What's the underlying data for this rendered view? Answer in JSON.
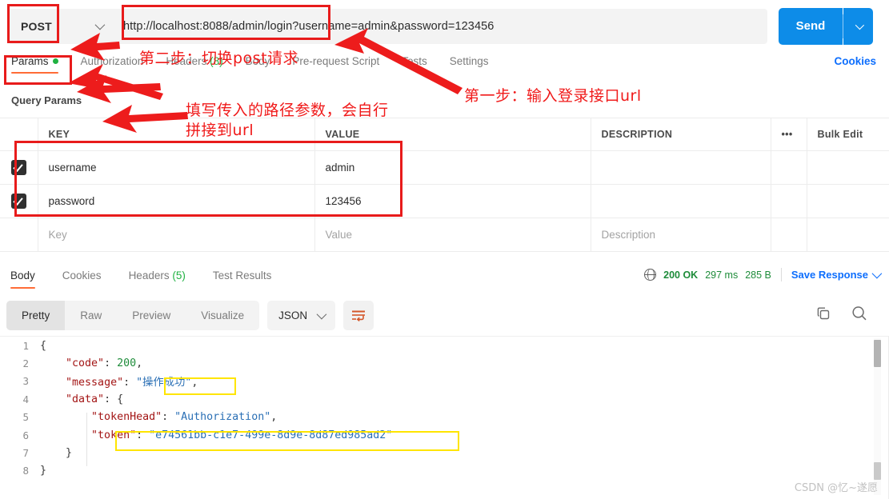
{
  "request": {
    "method": "POST",
    "url": "http://localhost:8088/admin/login?username=admin&password=123456",
    "send_label": "Send",
    "tabs": [
      {
        "label": "Params",
        "active": true,
        "dot": true
      },
      {
        "label": "Authorization",
        "active": false
      },
      {
        "label": "Headers",
        "count": "(8)",
        "active": false
      },
      {
        "label": "Body",
        "active": false
      },
      {
        "label": "Pre-request Script",
        "active": false
      },
      {
        "label": "Tests",
        "active": false
      },
      {
        "label": "Settings",
        "active": false
      }
    ],
    "cookies_link": "Cookies"
  },
  "query_params": {
    "title": "Query Params",
    "columns": [
      "KEY",
      "VALUE",
      "DESCRIPTION"
    ],
    "dots_label": "•••",
    "bulk_edit_label": "Bulk Edit",
    "rows": [
      {
        "checked": true,
        "key": "username",
        "value": "admin",
        "description": ""
      },
      {
        "checked": true,
        "key": "password",
        "value": "123456",
        "description": ""
      }
    ],
    "placeholder_row": {
      "key": "Key",
      "value": "Value",
      "description": "Description"
    }
  },
  "response": {
    "tabs": [
      {
        "label": "Body",
        "active": true
      },
      {
        "label": "Cookies",
        "active": false
      },
      {
        "label": "Headers",
        "count": "(5)",
        "active": false
      },
      {
        "label": "Test Results",
        "active": false
      }
    ],
    "status": {
      "code": "200 OK",
      "time": "297 ms",
      "size": "285 B",
      "save_label": "Save Response"
    },
    "view_modes": [
      {
        "label": "Pretty",
        "active": true
      },
      {
        "label": "Raw",
        "active": false
      },
      {
        "label": "Preview",
        "active": false
      },
      {
        "label": "Visualize",
        "active": false
      }
    ],
    "format": "JSON",
    "body_lines": [
      {
        "num": "1",
        "indent": 0,
        "tokens": [
          {
            "t": "{",
            "c": "p"
          }
        ]
      },
      {
        "num": "2",
        "indent": 1,
        "tokens": [
          {
            "t": "\"code\"",
            "c": "k"
          },
          {
            "t": ": ",
            "c": "p"
          },
          {
            "t": "200",
            "c": "n"
          },
          {
            "t": ",",
            "c": "p"
          }
        ]
      },
      {
        "num": "3",
        "indent": 1,
        "tokens": [
          {
            "t": "\"message\"",
            "c": "k"
          },
          {
            "t": ": ",
            "c": "p"
          },
          {
            "t": "\"操作成功\"",
            "c": "s"
          },
          {
            "t": ",",
            "c": "p"
          }
        ]
      },
      {
        "num": "4",
        "indent": 1,
        "tokens": [
          {
            "t": "\"data\"",
            "c": "k"
          },
          {
            "t": ": ",
            "c": "p"
          },
          {
            "t": "{",
            "c": "p"
          }
        ]
      },
      {
        "num": "5",
        "indent": 2,
        "tokens": [
          {
            "t": "\"tokenHead\"",
            "c": "k"
          },
          {
            "t": ": ",
            "c": "p"
          },
          {
            "t": "\"Authorization\"",
            "c": "s"
          },
          {
            "t": ",",
            "c": "p"
          }
        ]
      },
      {
        "num": "6",
        "indent": 2,
        "tokens": [
          {
            "t": "\"token\"",
            "c": "k"
          },
          {
            "t": ": ",
            "c": "p"
          },
          {
            "t": "\"e74561bb-c1e7-499e-8d9e-8d87ed985ad2\"",
            "c": "s"
          }
        ]
      },
      {
        "num": "7",
        "indent": 1,
        "tokens": [
          {
            "t": "}",
            "c": "p"
          }
        ]
      },
      {
        "num": "8",
        "indent": 0,
        "tokens": [
          {
            "t": "}",
            "c": "p"
          }
        ]
      }
    ]
  },
  "annotations": {
    "step2": "第二步：切换post请求",
    "step1": "第一步：输入登录接口url",
    "params_note_line1": "填写传入的路径参数，会自行",
    "params_note_line2": "拼接到url",
    "highlight_color": "#e81b1b",
    "json_highlight_color": "#ffe500"
  },
  "watermark": "CSDN @忆~遂愿"
}
